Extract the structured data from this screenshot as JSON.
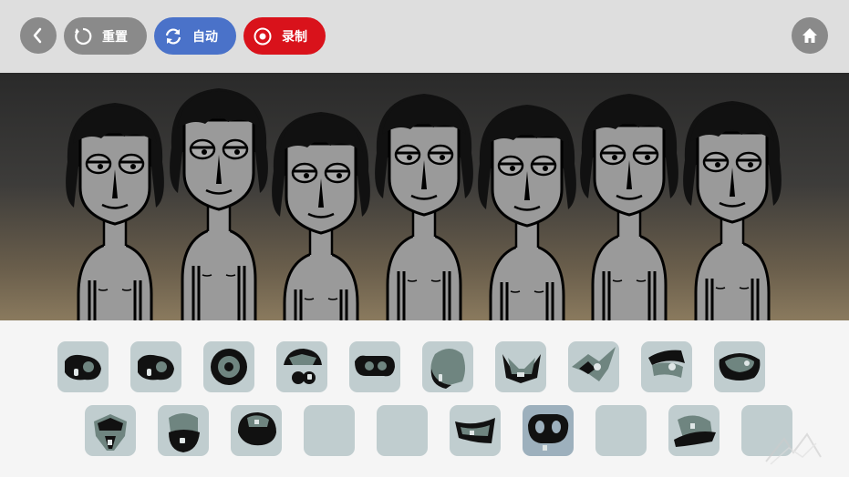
{
  "toolbar": {
    "reset_label": "重置",
    "auto_label": "自动",
    "record_label": "录制",
    "colors": {
      "gray": "#8a8a8a",
      "blue": "#4a72c9",
      "red": "#d9121b"
    }
  },
  "stage": {
    "performer_count": 7
  },
  "sound_slots": {
    "row1": [
      {
        "icon": "bass-shape-icon",
        "state": "filled"
      },
      {
        "icon": "bass-shape-icon",
        "state": "filled"
      },
      {
        "icon": "disc-shape-icon",
        "state": "filled"
      },
      {
        "icon": "cap-shape-icon",
        "state": "filled"
      },
      {
        "icon": "glasses-shape-icon",
        "state": "filled"
      },
      {
        "icon": "hair-shape-icon",
        "state": "filled"
      },
      {
        "icon": "mask-shape-icon",
        "state": "filled"
      },
      {
        "icon": "bird-shape-icon",
        "state": "filled"
      },
      {
        "icon": "visor-shape-icon",
        "state": "filled"
      },
      {
        "icon": "band-shape-icon",
        "state": "filled"
      }
    ],
    "row2": [
      {
        "icon": "helmet-shape-icon",
        "state": "filled"
      },
      {
        "icon": "beard-shape-icon",
        "state": "filled"
      },
      {
        "icon": "hat-shape-icon",
        "state": "filled"
      },
      {
        "icon": "",
        "state": "empty"
      },
      {
        "icon": "",
        "state": "empty"
      },
      {
        "icon": "wing-shape-icon",
        "state": "filled"
      },
      {
        "icon": "goggles-shape-icon",
        "state": "active"
      },
      {
        "icon": "",
        "state": "empty"
      },
      {
        "icon": "cap-side-shape-icon",
        "state": "filled"
      },
      {
        "icon": "",
        "state": "empty"
      }
    ]
  }
}
